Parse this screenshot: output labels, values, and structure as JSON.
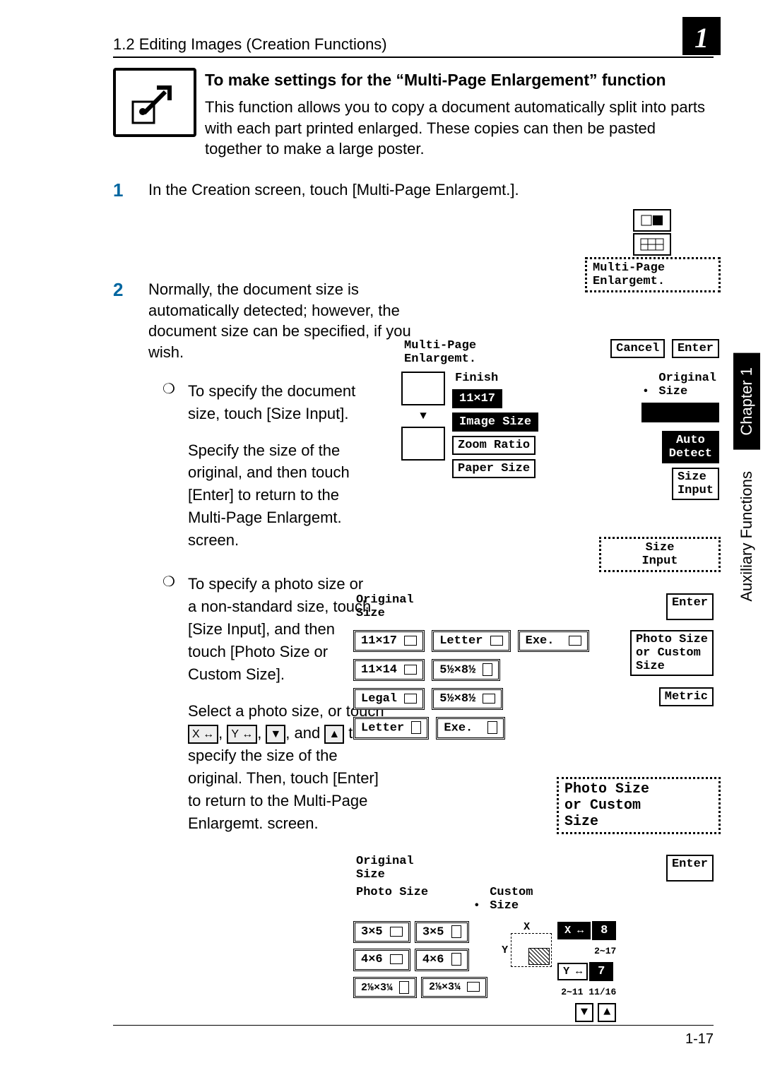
{
  "header": {
    "section": "1.2 Editing Images (Creation Functions)",
    "chapter_badge": "1"
  },
  "sidetab": {
    "chapter": "Chapter 1",
    "title": "Auxiliary Functions"
  },
  "title": "To make settings for the “Multi-Page Enlargement” function",
  "intro": "This function allows you to copy a document automatically split into parts with each part printed enlarged. These copies can then be pasted together to make a large poster.",
  "steps": {
    "s1": {
      "num": "1",
      "text": "In the Creation screen, touch [Multi-Page Enlargemt.]."
    },
    "s2": {
      "num": "2",
      "text": "Normally, the document size is automatically detected; however, the document size can be specified, if you wish."
    }
  },
  "sub": {
    "a": {
      "p1": "To specify the document size, touch [Size Input].",
      "p2": "Specify the size of the original, and then touch [Enter] to return to the Multi-Page Enlargemt. screen."
    },
    "b": {
      "p1": "To specify a photo size or a non-standard size, touch [Size Input], and then touch [Photo Size or Custom Size].",
      "p2a": "Select a photo size, or touch ",
      "p2b": ", ",
      "p2c": ", ",
      "p2d": ", and ",
      "p2e": " to specify the size of the original. Then, touch [Enter] to return to the Multi-Page Enlargemt. screen."
    }
  },
  "screen1": {
    "label": "Multi-Page\nEnlargemt."
  },
  "screen2": {
    "title": "Multi-Page\nEnlargemt.",
    "cancel": "Cancel",
    "enter": "Enter",
    "finish": "Finish",
    "finishsize": "11×17",
    "imagesize": "Image Size",
    "zoom": "Zoom Ratio",
    "paper": "Paper Size",
    "origlabel": "Original\nSize",
    "auto": "Auto\nDetect",
    "sizeinput": "Size\nInput"
  },
  "screen3": {
    "label": "Size\nInput"
  },
  "screen4": {
    "title": "Original\nSize",
    "enter": "Enter",
    "sizes": {
      "a": "11×17",
      "b": "Letter",
      "c": "Exe.",
      "d": "11×14",
      "e": "5½×8½",
      "f": "Legal",
      "g": "5½×8½",
      "h": "Letter",
      "i": "Exe."
    },
    "photo": "Photo Size\nor Custom\nSize",
    "metric": "Metric"
  },
  "screen5": {
    "label": "Photo Size\nor Custom\nSize"
  },
  "screen6": {
    "title": "Original\nSize",
    "enter": "Enter",
    "photosize": "Photo Size",
    "custom": "Custom\nSize",
    "sizes": {
      "a": "3×5",
      "b": "3×5",
      "c": "4×6",
      "d": "4×6",
      "e": "2⅛×3¼",
      "f": "2⅛×3¼"
    },
    "x": "X",
    "y": "Y",
    "xarrow": "X ↔",
    "yarrow": "Y ↔",
    "xval": "8",
    "xr": "2∼17",
    "yval": "7",
    "yr": "2∼11 11/16",
    "down": "▼",
    "up": "▲"
  },
  "inline": {
    "x": "X ↔",
    "y": "Y ↔",
    "down": "▼",
    "up": "▲"
  },
  "footer": {
    "page": "1-17"
  }
}
